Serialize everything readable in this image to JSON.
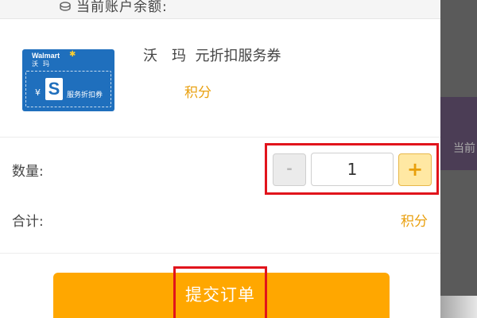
{
  "header": {
    "balance_label": "当前账户余额:",
    "balance_icon": "coins-icon"
  },
  "product": {
    "coupon_image": {
      "brand": "Walmart",
      "brand_sub": "沃玛",
      "currency": "¥",
      "logo_letter": "S",
      "coupon_type": "服务折扣券",
      "color": "#1f6fbd"
    },
    "name": "沃　玛  元折扣服务券",
    "points_label": "积分"
  },
  "quantity": {
    "label": "数量:",
    "minus_label": "-",
    "value": "1",
    "plus_label": "+"
  },
  "total": {
    "label": "合计:",
    "value": "积分"
  },
  "submit": {
    "label": "提交订单",
    "color": "#ffa700"
  },
  "background_page": {
    "text": "当前"
  },
  "colors": {
    "accent": "#e9a00f",
    "highlight": "#e1141c"
  }
}
